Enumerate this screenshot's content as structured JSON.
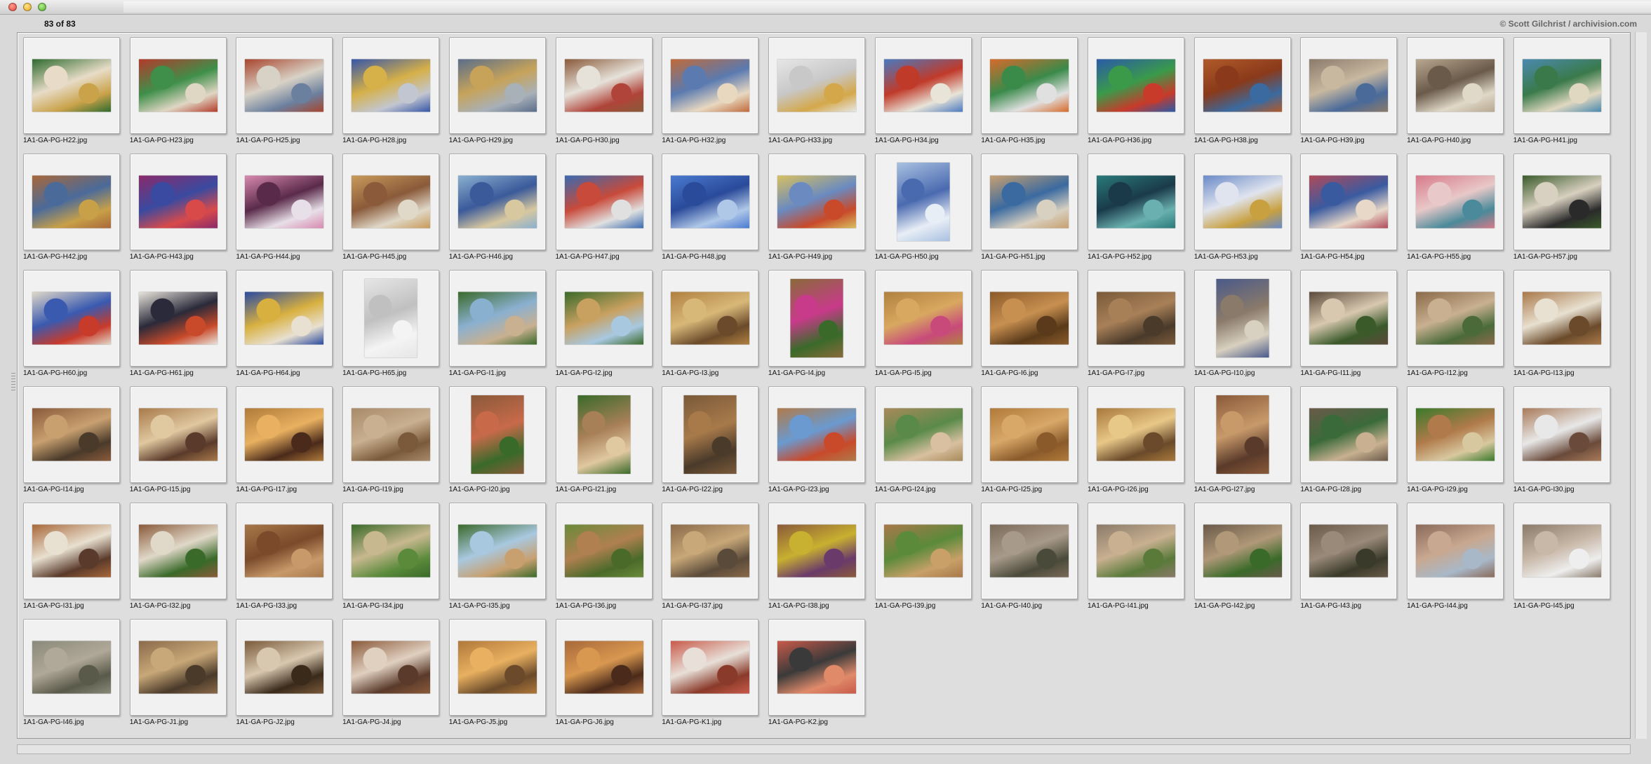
{
  "window": {
    "counter": "83 of 83",
    "copyright": "© Scott Gilchrist / archivision.com"
  },
  "thumbnails": [
    {
      "name": "1A1-GA-PG-H22.jpg",
      "orientation": "landscape",
      "colors": [
        "#2e6b2e",
        "#e8dcc8",
        "#c9a24a"
      ]
    },
    {
      "name": "1A1-GA-PG-H23.jpg",
      "orientation": "landscape",
      "colors": [
        "#b33a2a",
        "#3f8f4a",
        "#e0d6c4"
      ]
    },
    {
      "name": "1A1-GA-PG-H25.jpg",
      "orientation": "landscape",
      "colors": [
        "#a8452d",
        "#d8d2c6",
        "#6b7f9e"
      ]
    },
    {
      "name": "1A1-GA-PG-H28.jpg",
      "orientation": "landscape",
      "colors": [
        "#3555a8",
        "#d6b048",
        "#c2c6d0"
      ]
    },
    {
      "name": "1A1-GA-PG-H29.jpg",
      "orientation": "landscape",
      "colors": [
        "#5a6d8a",
        "#c7a35a",
        "#a8b0b8"
      ]
    },
    {
      "name": "1A1-GA-PG-H30.jpg",
      "orientation": "landscape",
      "colors": [
        "#8a5a3a",
        "#e6e2da",
        "#b0443a"
      ]
    },
    {
      "name": "1A1-GA-PG-H32.jpg",
      "orientation": "landscape",
      "colors": [
        "#c06a3a",
        "#5a7ab0",
        "#e8d8c0"
      ]
    },
    {
      "name": "1A1-GA-PG-H33.jpg",
      "orientation": "landscape",
      "colors": [
        "#e6e6e6",
        "#c8c8c8",
        "#d4a84a"
      ]
    },
    {
      "name": "1A1-GA-PG-H34.jpg",
      "orientation": "landscape",
      "colors": [
        "#4a7ac0",
        "#c03a2a",
        "#e8e4d8"
      ]
    },
    {
      "name": "1A1-GA-PG-H35.jpg",
      "orientation": "landscape",
      "colors": [
        "#d86a2a",
        "#3a8a4a",
        "#e0e0e0"
      ]
    },
    {
      "name": "1A1-GA-PG-H36.jpg",
      "orientation": "landscape",
      "colors": [
        "#2a5aa8",
        "#3a9a4a",
        "#c83a2a"
      ]
    },
    {
      "name": "1A1-GA-PG-H38.jpg",
      "orientation": "landscape",
      "colors": [
        "#b05a2a",
        "#8a3a1a",
        "#3a6aa0"
      ]
    },
    {
      "name": "1A1-GA-PG-H39.jpg",
      "orientation": "landscape",
      "colors": [
        "#8a7a6a",
        "#c8b8a0",
        "#4a6a9a"
      ]
    },
    {
      "name": "1A1-GA-PG-H40.jpg",
      "orientation": "landscape",
      "colors": [
        "#b8a890",
        "#6a5a4a",
        "#e0d8c8"
      ]
    },
    {
      "name": "1A1-GA-PG-H41.jpg",
      "orientation": "landscape",
      "colors": [
        "#4a8ab0",
        "#3a7a4a",
        "#e0d8c0"
      ]
    },
    {
      "name": "1A1-GA-PG-H42.jpg",
      "orientation": "landscape",
      "colors": [
        "#a8683a",
        "#4a6a9a",
        "#c8a048"
      ]
    },
    {
      "name": "1A1-GA-PG-H43.jpg",
      "orientation": "landscape",
      "colors": [
        "#8a2a6a",
        "#3a4aa0",
        "#d84a4a"
      ]
    },
    {
      "name": "1A1-GA-PG-H44.jpg",
      "orientation": "landscape",
      "colors": [
        "#d88ab0",
        "#5a2a4a",
        "#e8e0e8"
      ]
    },
    {
      "name": "1A1-GA-PG-H45.jpg",
      "orientation": "landscape",
      "colors": [
        "#c89a5a",
        "#8a5a3a",
        "#e0d8c8"
      ]
    },
    {
      "name": "1A1-GA-PG-H46.jpg",
      "orientation": "landscape",
      "colors": [
        "#8ab0d0",
        "#3a5a9a",
        "#d8c8a0"
      ]
    },
    {
      "name": "1A1-GA-PG-H47.jpg",
      "orientation": "landscape",
      "colors": [
        "#3a6ab0",
        "#c84a3a",
        "#e0e0e0"
      ]
    },
    {
      "name": "1A1-GA-PG-H48.jpg",
      "orientation": "landscape",
      "colors": [
        "#4a7ad0",
        "#2a4a9a",
        "#b0c8e8"
      ]
    },
    {
      "name": "1A1-GA-PG-H49.jpg",
      "orientation": "landscape",
      "colors": [
        "#d8c060",
        "#6a8ac0",
        "#c84a2a"
      ]
    },
    {
      "name": "1A1-GA-PG-H50.jpg",
      "orientation": "portrait",
      "colors": [
        "#a8c0e0",
        "#4a6ab0",
        "#e8eef6"
      ]
    },
    {
      "name": "1A1-GA-PG-H51.jpg",
      "orientation": "landscape",
      "colors": [
        "#c8a070",
        "#3a6aa0",
        "#d8d0c0"
      ]
    },
    {
      "name": "1A1-GA-PG-H52.jpg",
      "orientation": "landscape",
      "colors": [
        "#2a7a7a",
        "#1a3a4a",
        "#6ab0b0"
      ]
    },
    {
      "name": "1A1-GA-PG-H53.jpg",
      "orientation": "landscape",
      "colors": [
        "#6a8ac8",
        "#e0e4ee",
        "#c8a040"
      ]
    },
    {
      "name": "1A1-GA-PG-H54.jpg",
      "orientation": "landscape",
      "colors": [
        "#b04a5a",
        "#3a5aa0",
        "#e8d8c8"
      ]
    },
    {
      "name": "1A1-GA-PG-H55.jpg",
      "orientation": "landscape",
      "colors": [
        "#d87a8a",
        "#e8c8c8",
        "#4a8a9a"
      ]
    },
    {
      "name": "1A1-GA-PG-H57.jpg",
      "orientation": "landscape",
      "colors": [
        "#3a5a2a",
        "#d8d0c0",
        "#2a2a2a"
      ]
    },
    {
      "name": "1A1-GA-PG-H60.jpg",
      "orientation": "landscape",
      "colors": [
        "#e0d8c8",
        "#3a5ab0",
        "#c83a2a"
      ]
    },
    {
      "name": "1A1-GA-PG-H61.jpg",
      "orientation": "landscape",
      "colors": [
        "#e8e4dc",
        "#2a2a3a",
        "#c84a2a"
      ]
    },
    {
      "name": "1A1-GA-PG-H64.jpg",
      "orientation": "landscape",
      "colors": [
        "#2a4aa0",
        "#d8b040",
        "#e8e0d0"
      ]
    },
    {
      "name": "1A1-GA-PG-H65.jpg",
      "orientation": "portrait",
      "colors": [
        "#e6e6e6",
        "#c0c0c0",
        "#f4f4f4"
      ]
    },
    {
      "name": "1A1-GA-PG-I1.jpg",
      "orientation": "landscape",
      "colors": [
        "#3a6a2a",
        "#8ab0d0",
        "#c8b090"
      ]
    },
    {
      "name": "1A1-GA-PG-I2.jpg",
      "orientation": "landscape",
      "colors": [
        "#3a6a2a",
        "#c8a060",
        "#a8c8e0"
      ]
    },
    {
      "name": "1A1-GA-PG-I3.jpg",
      "orientation": "landscape",
      "colors": [
        "#b08040",
        "#d8b878",
        "#6a4a2a"
      ]
    },
    {
      "name": "1A1-GA-PG-I4.jpg",
      "orientation": "portrait",
      "colors": [
        "#8a6a3a",
        "#c83a8a",
        "#3a6a2a"
      ]
    },
    {
      "name": "1A1-GA-PG-I5.jpg",
      "orientation": "landscape",
      "colors": [
        "#b08040",
        "#d8a860",
        "#c84a7a"
      ]
    },
    {
      "name": "1A1-GA-PG-I6.jpg",
      "orientation": "landscape",
      "colors": [
        "#8a5a2a",
        "#c89050",
        "#5a3a1a"
      ]
    },
    {
      "name": "1A1-GA-PG-I7.jpg",
      "orientation": "landscape",
      "colors": [
        "#7a5a3a",
        "#a88058",
        "#4a3a2a"
      ]
    },
    {
      "name": "1A1-GA-PG-I10.jpg",
      "orientation": "portrait",
      "colors": [
        "#4a5a8a",
        "#8a7a6a",
        "#d8d0c0"
      ]
    },
    {
      "name": "1A1-GA-PG-I11.jpg",
      "orientation": "landscape",
      "colors": [
        "#5a4a3a",
        "#d8c8b0",
        "#3a5a2a"
      ]
    },
    {
      "name": "1A1-GA-PG-I12.jpg",
      "orientation": "landscape",
      "colors": [
        "#8a6a4a",
        "#c8b090",
        "#4a6a3a"
      ]
    },
    {
      "name": "1A1-GA-PG-I13.jpg",
      "orientation": "landscape",
      "colors": [
        "#a8784a",
        "#e8e0d0",
        "#6a4a2a"
      ]
    },
    {
      "name": "1A1-GA-PG-I14.jpg",
      "orientation": "landscape",
      "colors": [
        "#8a5a3a",
        "#c8a070",
        "#4a3a2a"
      ]
    },
    {
      "name": "1A1-GA-PG-I15.jpg",
      "orientation": "landscape",
      "colors": [
        "#a87a4a",
        "#e0c8a0",
        "#5a3a2a"
      ]
    },
    {
      "name": "1A1-GA-PG-I17.jpg",
      "orientation": "landscape",
      "colors": [
        "#b07a3a",
        "#e8b060",
        "#4a2a1a"
      ]
    },
    {
      "name": "1A1-GA-PG-I19.jpg",
      "orientation": "landscape",
      "colors": [
        "#a88a6a",
        "#c8b090",
        "#7a5a3a"
      ]
    },
    {
      "name": "1A1-GA-PG-I20.jpg",
      "orientation": "portrait",
      "colors": [
        "#8a5a3a",
        "#c86a4a",
        "#3a6a2a"
      ]
    },
    {
      "name": "1A1-GA-PG-I21.jpg",
      "orientation": "portrait",
      "colors": [
        "#3a6a2a",
        "#a88058",
        "#e0c8a0"
      ]
    },
    {
      "name": "1A1-GA-PG-I22.jpg",
      "orientation": "portrait",
      "colors": [
        "#7a5a3a",
        "#a87a4a",
        "#4a3a2a"
      ]
    },
    {
      "name": "1A1-GA-PG-I23.jpg",
      "orientation": "landscape",
      "colors": [
        "#b07a4a",
        "#6a9ad0",
        "#c84a2a"
      ]
    },
    {
      "name": "1A1-GA-PG-I24.jpg",
      "orientation": "landscape",
      "colors": [
        "#a88a5a",
        "#5a8a4a",
        "#d8c0a0"
      ]
    },
    {
      "name": "1A1-GA-PG-I25.jpg",
      "orientation": "landscape",
      "colors": [
        "#b07a3a",
        "#d8a868",
        "#8a5a2a"
      ]
    },
    {
      "name": "1A1-GA-PG-I26.jpg",
      "orientation": "landscape",
      "colors": [
        "#a8783a",
        "#e8c888",
        "#6a4a2a"
      ]
    },
    {
      "name": "1A1-GA-PG-I27.jpg",
      "orientation": "portrait",
      "colors": [
        "#8a5a3a",
        "#c89a6a",
        "#5a3a2a"
      ]
    },
    {
      "name": "1A1-GA-PG-I28.jpg",
      "orientation": "landscape",
      "colors": [
        "#6a5a4a",
        "#3a6a3a",
        "#c8b090"
      ]
    },
    {
      "name": "1A1-GA-PG-I29.jpg",
      "orientation": "landscape",
      "colors": [
        "#3a7a2a",
        "#b07a4a",
        "#d8c8a0"
      ]
    },
    {
      "name": "1A1-GA-PG-I30.jpg",
      "orientation": "landscape",
      "colors": [
        "#a87a5a",
        "#e8e8e8",
        "#6a4a3a"
      ]
    },
    {
      "name": "1A1-GA-PG-I31.jpg",
      "orientation": "landscape",
      "colors": [
        "#a8683a",
        "#e8e0d0",
        "#5a3a2a"
      ]
    },
    {
      "name": "1A1-GA-PG-I32.jpg",
      "orientation": "landscape",
      "colors": [
        "#8a5a3a",
        "#e0d8c8",
        "#3a6a2a"
      ]
    },
    {
      "name": "1A1-GA-PG-I33.jpg",
      "orientation": "landscape",
      "colors": [
        "#a8784a",
        "#7a4a2a",
        "#c89a6a"
      ]
    },
    {
      "name": "1A1-GA-PG-I34.jpg",
      "orientation": "landscape",
      "colors": [
        "#3a6a2a",
        "#c8b890",
        "#5a8a3a"
      ]
    },
    {
      "name": "1A1-GA-PG-I35.jpg",
      "orientation": "landscape",
      "colors": [
        "#3a6a2a",
        "#a8c8e0",
        "#c8a070"
      ]
    },
    {
      "name": "1A1-GA-PG-I36.jpg",
      "orientation": "landscape",
      "colors": [
        "#6a8a3a",
        "#b08050",
        "#4a6a2a"
      ]
    },
    {
      "name": "1A1-GA-PG-I37.jpg",
      "orientation": "landscape",
      "colors": [
        "#8a6a4a",
        "#c8a878",
        "#5a4a3a"
      ]
    },
    {
      "name": "1A1-GA-PG-I38.jpg",
      "orientation": "landscape",
      "colors": [
        "#8a5a3a",
        "#c8b030",
        "#6a3a6a"
      ]
    },
    {
      "name": "1A1-GA-PG-I39.jpg",
      "orientation": "landscape",
      "colors": [
        "#a8784a",
        "#5a8a3a",
        "#c8a068"
      ]
    },
    {
      "name": "1A1-GA-PG-I40.jpg",
      "orientation": "landscape",
      "colors": [
        "#7a6a5a",
        "#a89a8a",
        "#4a4a3a"
      ]
    },
    {
      "name": "1A1-GA-PG-I41.jpg",
      "orientation": "landscape",
      "colors": [
        "#8a7a6a",
        "#c8b090",
        "#5a7a3a"
      ]
    },
    {
      "name": "1A1-GA-PG-I42.jpg",
      "orientation": "landscape",
      "colors": [
        "#6a5a4a",
        "#b09878",
        "#3a6a2a"
      ]
    },
    {
      "name": "1A1-GA-PG-I43.jpg",
      "orientation": "landscape",
      "colors": [
        "#6a5a4a",
        "#9a8a7a",
        "#3a3a2a"
      ]
    },
    {
      "name": "1A1-GA-PG-I44.jpg",
      "orientation": "landscape",
      "colors": [
        "#8a6a5a",
        "#c8a890",
        "#a8b8c8"
      ]
    },
    {
      "name": "1A1-GA-PG-I45.jpg",
      "orientation": "landscape",
      "colors": [
        "#8a7a6a",
        "#c8b8a8",
        "#eeeeee"
      ]
    },
    {
      "name": "1A1-GA-PG-I46.jpg",
      "orientation": "landscape",
      "colors": [
        "#8a8a7a",
        "#b0a898",
        "#5a5a4a"
      ]
    },
    {
      "name": "1A1-GA-PG-J1.jpg",
      "orientation": "landscape",
      "colors": [
        "#8a6a4a",
        "#c8a878",
        "#4a3a2a"
      ]
    },
    {
      "name": "1A1-GA-PG-J2.jpg",
      "orientation": "landscape",
      "colors": [
        "#7a5a3a",
        "#d8c8b0",
        "#3a2a1a"
      ]
    },
    {
      "name": "1A1-GA-PG-J4.jpg",
      "orientation": "landscape",
      "colors": [
        "#8a5a3a",
        "#e0d0c0",
        "#5a3a2a"
      ]
    },
    {
      "name": "1A1-GA-PG-J5.jpg",
      "orientation": "landscape",
      "colors": [
        "#b0783a",
        "#e8b060",
        "#6a4a2a"
      ]
    },
    {
      "name": "1A1-GA-PG-J6.jpg",
      "orientation": "landscape",
      "colors": [
        "#a8683a",
        "#d89850",
        "#4a2a1a"
      ]
    },
    {
      "name": "1A1-GA-PG-K1.jpg",
      "orientation": "landscape",
      "colors": [
        "#c85a4a",
        "#e8e0d8",
        "#8a3a2a"
      ]
    },
    {
      "name": "1A1-GA-PG-K2.jpg",
      "orientation": "landscape",
      "colors": [
        "#c85a4a",
        "#3a3a3a",
        "#e08a6a"
      ]
    }
  ]
}
